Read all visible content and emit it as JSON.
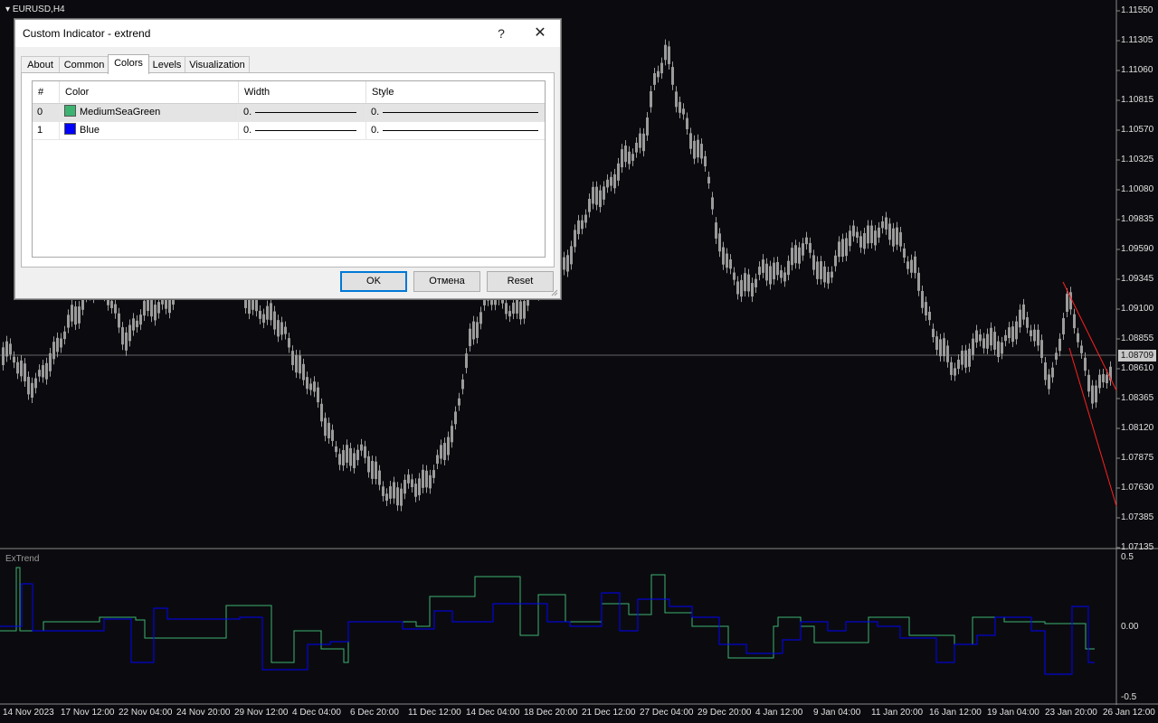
{
  "chart": {
    "symbol": "EURUSD,H4",
    "current_price": "1.08709",
    "price_axis": [
      "1.11550",
      "1.11305",
      "1.11060",
      "1.10815",
      "1.10570",
      "1.10325",
      "1.10080",
      "1.09835",
      "1.09590",
      "1.09345",
      "1.09100",
      "1.08855",
      "1.08610",
      "1.08365",
      "1.08120",
      "1.07875",
      "1.07630",
      "1.07385",
      "1.07135"
    ],
    "time_axis": [
      "14 Nov 2023",
      "17 Nov 12:00",
      "22 Nov 04:00",
      "24 Nov 20:00",
      "29 Nov 12:00",
      "4 Dec 04:00",
      "6 Dec 20:00",
      "11 Dec 12:00",
      "14 Dec 04:00",
      "18 Dec 20:00",
      "21 Dec 12:00",
      "27 Dec 04:00",
      "29 Dec 20:00",
      "4 Jan 12:00",
      "9 Jan 04:00",
      "11 Jan 20:00",
      "16 Jan 12:00",
      "19 Jan 04:00",
      "23 Jan 20:00",
      "26 Jan 12:00"
    ],
    "colors": {
      "background": "#0b0b0f",
      "candles": "#9b9b9b",
      "trendline": "#ff2020",
      "green_line": "#3cb371",
      "blue_line": "#0000ff"
    }
  },
  "indicator": {
    "name": "ExTrend",
    "axis": [
      "0.5",
      "0.00",
      "-0.5"
    ]
  },
  "dialog": {
    "title": "Custom Indicator - extrend",
    "help": "?",
    "close": "✕",
    "tabs": [
      "About",
      "Common",
      "Colors",
      "Levels",
      "Visualization"
    ],
    "active_tab": "Colors",
    "columns": [
      "#",
      "Color",
      "Width",
      "Style"
    ],
    "rows": [
      {
        "index": "0",
        "color_name": "MediumSeaGreen",
        "color": "#3cb371",
        "width": "0.",
        "style": "0."
      },
      {
        "index": "1",
        "color_name": "Blue",
        "color": "#0000ff",
        "width": "0.",
        "style": "0."
      }
    ],
    "buttons": {
      "ok": "OK",
      "cancel": "Отмена",
      "reset": "Reset"
    }
  }
}
